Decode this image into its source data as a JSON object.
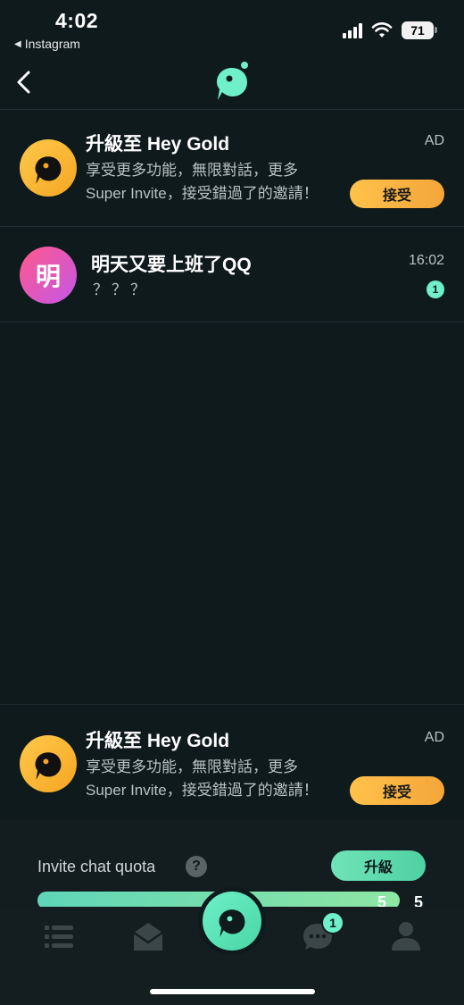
{
  "status_bar": {
    "time": "4:02",
    "back_app": "Instagram",
    "battery": "71"
  },
  "colors": {
    "background": "#0e1a1c",
    "accent_green": "#6ff0c8",
    "gold": "#f5a623"
  },
  "chat_list": [
    {
      "type": "ad",
      "title": "升級至 Hey Gold",
      "line1": "享受更多功能，無限對話，更多",
      "line2": "Super Invite，接受錯過了的邀請！",
      "tag": "AD",
      "button": "接受",
      "avatar_icon": "hey-logo-icon"
    },
    {
      "type": "chat",
      "avatar_text": "明",
      "name": "明天又要上班了QQ",
      "preview": "？？？",
      "time": "16:02",
      "unread": "1"
    }
  ],
  "bottom_ad": {
    "title": "升級至 Hey Gold",
    "line1": "享受更多功能，無限對話，更多",
    "line2": "Super Invite，接受錯過了的邀請！",
    "tag": "AD",
    "button": "接受"
  },
  "quota": {
    "label": "Invite chat quota",
    "help": "?",
    "upgrade_button": "升級",
    "current": "5",
    "total": "5",
    "fill_fraction": 1.0
  },
  "tabbar": {
    "items": [
      "list-icon",
      "mail-icon",
      "home-logo-icon",
      "chat-icon",
      "profile-icon"
    ],
    "chat_badge": "1"
  }
}
